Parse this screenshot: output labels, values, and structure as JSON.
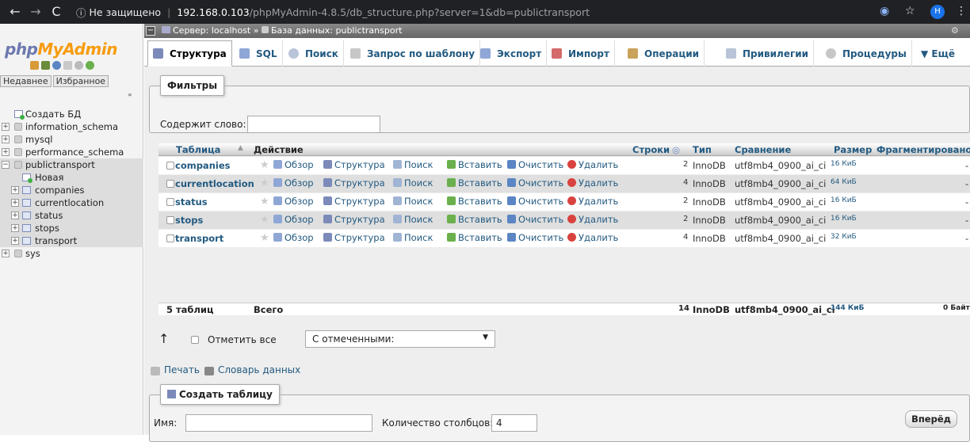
{
  "browser": {
    "security_label": "Не защищено",
    "url_host": "192.168.0.103",
    "url_path": "/phpMyAdmin-4.8.5/db_structure.php?server=1&db=publictransport",
    "avatar_letter": "H"
  },
  "sidebar": {
    "logo_php": "php",
    "logo_myadmin": "MyAdmin",
    "tab_recent": "Недавнее",
    "tab_favorites": "Избранное",
    "tree": [
      {
        "label": "Создать БД"
      },
      {
        "label": "information_schema"
      },
      {
        "label": "mysql"
      },
      {
        "label": "performance_schema"
      },
      {
        "label": "publictransport"
      },
      {
        "label": "Новая"
      },
      {
        "label": "companies"
      },
      {
        "label": "currentlocation"
      },
      {
        "label": "status"
      },
      {
        "label": "stops"
      },
      {
        "label": "transport"
      },
      {
        "label": "sys"
      }
    ]
  },
  "breadcrumb": {
    "server": "Сервер: localhost",
    "sep": "»",
    "database": "База данных: publictransport"
  },
  "tabs": [
    {
      "label": "Структура"
    },
    {
      "label": "SQL"
    },
    {
      "label": "Поиск"
    },
    {
      "label": "Запрос по шаблону"
    },
    {
      "label": "Экспорт"
    },
    {
      "label": "Импорт"
    },
    {
      "label": "Операции"
    },
    {
      "label": "Привилегии"
    },
    {
      "label": "Процедуры"
    },
    {
      "label": "▼ Ещё"
    }
  ],
  "filters": {
    "legend": "Фильтры",
    "contains_label": "Содержит слово:",
    "contains_value": ""
  },
  "table": {
    "headers": {
      "table": "Таблица",
      "action": "Действие",
      "rows": "Строки",
      "type": "Тип",
      "collation": "Сравнение",
      "size": "Размер",
      "overhead": "Фрагментировано"
    },
    "actions": {
      "browse": "Обзор",
      "structure": "Структура",
      "search": "Поиск",
      "insert": "Вставить",
      "empty": "Очистить",
      "drop": "Удалить"
    },
    "rows": [
      {
        "name": "companies",
        "rows": "2",
        "type": "InnoDB",
        "collation": "utf8mb4_0900_ai_ci",
        "size": "16 КиБ",
        "overhead": "-"
      },
      {
        "name": "currentlocation",
        "rows": "4",
        "type": "InnoDB",
        "collation": "utf8mb4_0900_ai_ci",
        "size": "64 КиБ",
        "overhead": "-"
      },
      {
        "name": "status",
        "rows": "2",
        "type": "InnoDB",
        "collation": "utf8mb4_0900_ai_ci",
        "size": "16 КиБ",
        "overhead": "-"
      },
      {
        "name": "stops",
        "rows": "2",
        "type": "InnoDB",
        "collation": "utf8mb4_0900_ai_ci",
        "size": "16 КиБ",
        "overhead": "-"
      },
      {
        "name": "transport",
        "rows": "4",
        "type": "InnoDB",
        "collation": "utf8mb4_0900_ai_ci",
        "size": "32 КиБ",
        "overhead": "-"
      }
    ],
    "total": {
      "name": "5 таблиц",
      "label": "Всего",
      "rows": "14",
      "type": "InnoDB",
      "collation": "utf8mb4_0900_ai_ci",
      "size": "144 КиБ",
      "overhead": "0 Байт"
    }
  },
  "bulk": {
    "check_all": "Отметить все",
    "with_selected": "С отмеченными:"
  },
  "links": {
    "print": "Печать",
    "dictionary": "Словарь данных"
  },
  "create_table": {
    "legend": "Создать таблицу",
    "name_label": "Имя:",
    "name_value": "",
    "columns_label": "Количество столбцов:",
    "columns_value": "4",
    "go_button": "Вперёд"
  }
}
